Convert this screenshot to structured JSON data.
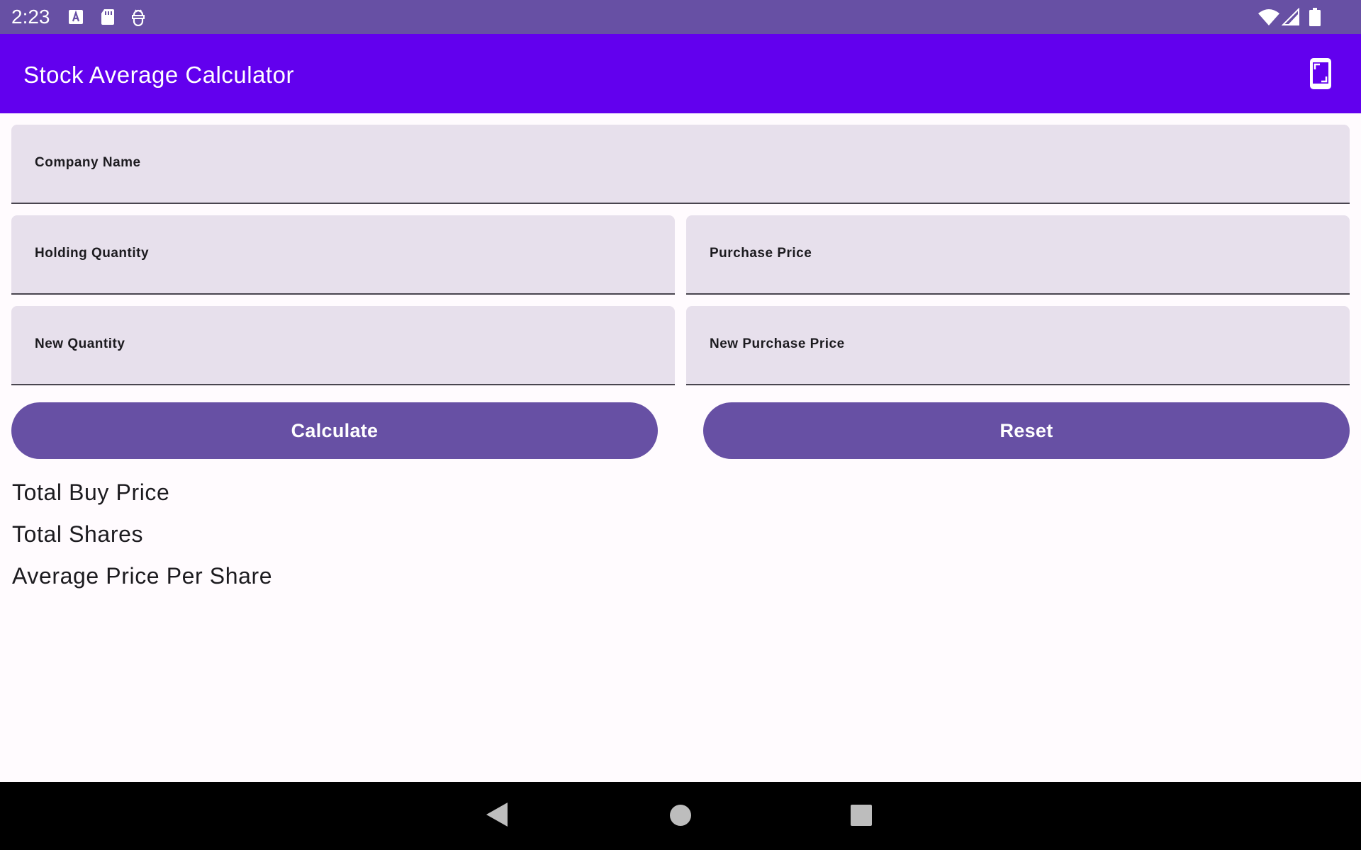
{
  "status_bar": {
    "time": "2:23",
    "icons": [
      "font-notification-icon",
      "sd-card-icon",
      "robot-notification-icon",
      "wifi-icon",
      "cellular-signal-icon",
      "battery-icon"
    ]
  },
  "app_bar": {
    "title": "Stock Average Calculator",
    "action_icon": "screen-rotation-icon"
  },
  "form": {
    "company_name": {
      "label": "Company Name",
      "value": ""
    },
    "holding_quantity": {
      "label": "Holding Quantity",
      "value": ""
    },
    "purchase_price": {
      "label": "Purchase Price",
      "value": ""
    },
    "new_quantity": {
      "label": "New Quantity",
      "value": ""
    },
    "new_purchase_price": {
      "label": "New Purchase Price",
      "value": ""
    }
  },
  "buttons": {
    "calculate": "Calculate",
    "reset": "Reset"
  },
  "results": {
    "total_buy_price": "Total Buy Price",
    "total_shares": "Total Shares",
    "average_price_per_share": "Average Price Per Share"
  },
  "nav_bar": {
    "icons": [
      "back-icon",
      "home-icon",
      "recents-icon"
    ]
  },
  "colors": {
    "status_bar": "#6750a4",
    "app_bar": "#6200ee",
    "field_background": "#e7e0ec",
    "button": "#6750a4",
    "background": "#fffbfe",
    "nav_bar": "#000000"
  }
}
